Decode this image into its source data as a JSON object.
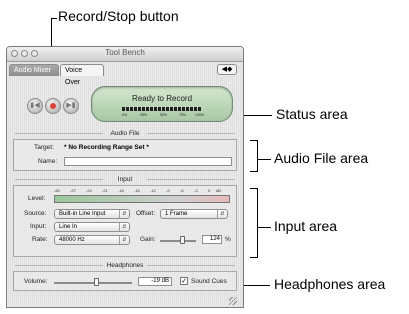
{
  "annotations": {
    "record_stop": "Record/Stop button",
    "status": "Status area",
    "audio_file": "Audio File area",
    "input": "Input area",
    "headphones": "Headphones area"
  },
  "window": {
    "title": "Tool Bench",
    "tabs": [
      "Audio Mixer",
      "Voice Over"
    ],
    "active_tab": "Voice Over"
  },
  "status": {
    "text": "Ready to Record",
    "meter_labels": [
      "0%",
      "25%",
      "50%",
      "75%",
      "100%"
    ]
  },
  "audio_file": {
    "header": "Audio File",
    "target_label": "Target:",
    "target_value": "* No Recording Range Set *",
    "name_label": "Name:",
    "name_value": ""
  },
  "input": {
    "header": "Input",
    "level_label": "Level:",
    "level_scale": [
      "-60",
      "-27",
      "-24",
      "-21",
      "-18",
      "-15",
      "-12",
      "-9",
      "-6",
      "-3",
      "0",
      "dB"
    ],
    "source_label": "Source:",
    "source_value": "Built-in Line Input",
    "offset_label": "Offset:",
    "offset_value": "1 Frame",
    "input_label": "Input:",
    "input_value": "Line In",
    "rate_label": "Rate:",
    "rate_value": "48000 Hz",
    "gain_label": "Gain:",
    "gain_value": "124",
    "gain_unit": "%"
  },
  "headphones": {
    "header": "Headphones",
    "volume_label": "Volume:",
    "volume_value": "-19 dB",
    "sound_cues_label": "Sound Cues",
    "sound_cues_checked": true
  }
}
